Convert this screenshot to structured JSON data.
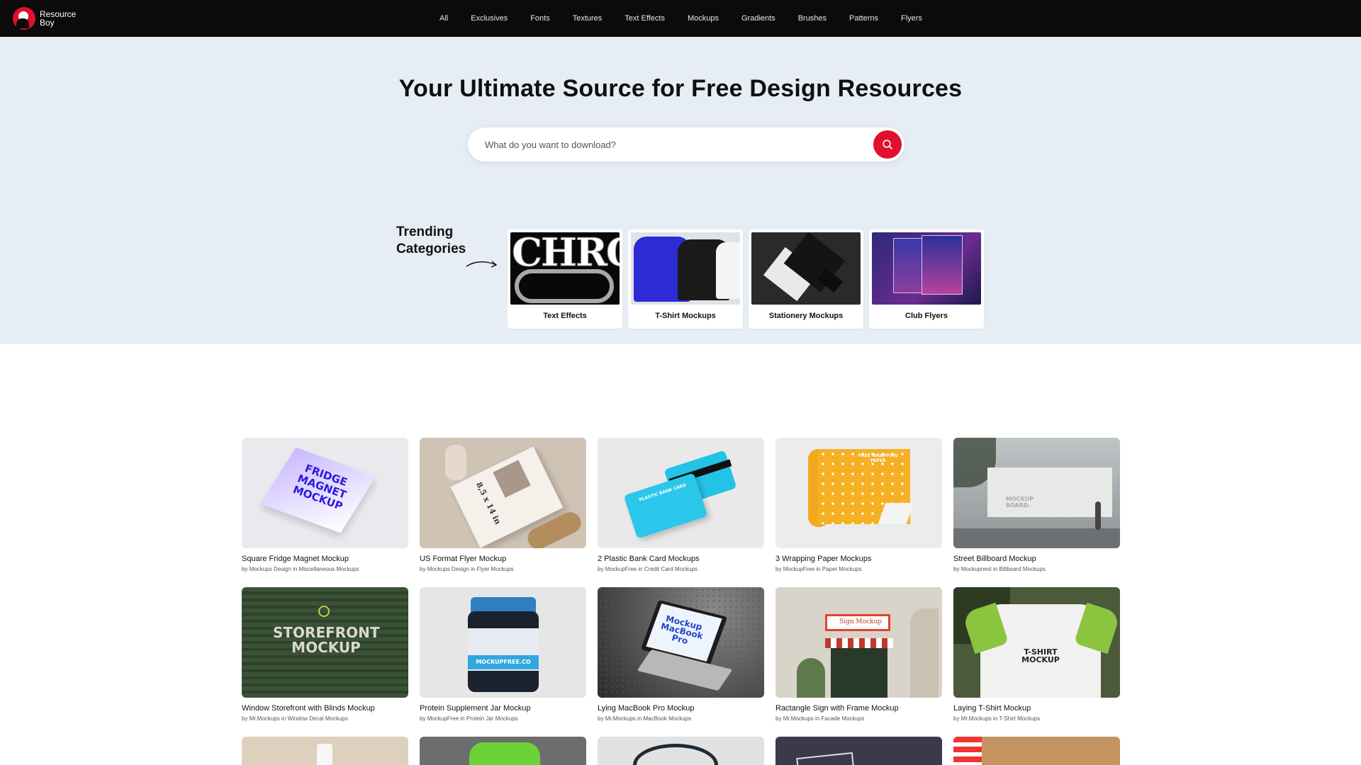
{
  "brand": {
    "name_line1": "Resource",
    "name_line2": "Boy",
    "accent": "#e0102f"
  },
  "nav": [
    "All",
    "Exclusives",
    "Fonts",
    "Textures",
    "Text Effects",
    "Mockups",
    "Gradients",
    "Brushes",
    "Patterns",
    "Flyers"
  ],
  "hero": {
    "title": "Your Ultimate Source for Free Design Resources",
    "search_placeholder": "What do you want to download?",
    "trending_line1": "Trending",
    "trending_line2": "Categories"
  },
  "categories": [
    {
      "label": "Text Effects",
      "art": "CHRO"
    },
    {
      "label": "T-Shirt Mockups"
    },
    {
      "label": "Stationery Mockups"
    },
    {
      "label": "Club Flyers"
    }
  ],
  "resources": [
    {
      "title": "Square Fridge Magnet Mockup",
      "by": "Mockups Design",
      "in": "Miscellaneous Mockups",
      "art": "FRIDGE MAGNET MOCKUP"
    },
    {
      "title": "US Format Flyer Mockup",
      "by": "Mockups Design",
      "in": "Flyer Mockups",
      "art": "8,5 x 14 in"
    },
    {
      "title": "2 Plastic Bank Card Mockups",
      "by": "MockupFree",
      "in": "Credit Card Mockups",
      "art": "PLASTIC BANK CARD"
    },
    {
      "title": "3 Wrapping Paper Mockups",
      "by": "MockupFree",
      "in": "Paper Mockups",
      "art": "FREE WRAPPING PAPER"
    },
    {
      "title": "Street Billboard Mockup",
      "by": "Mockupnest",
      "in": "Billboard Mockups",
      "art": "MOCKUP BOARD."
    },
    {
      "title": "Window Storefront with Blinds Mockup",
      "by": "Mr.Mockups",
      "in": "Window Decal Mockups",
      "art": "STOREFRONT MOCKUP"
    },
    {
      "title": "Protein Supplement Jar Mockup",
      "by": "MockupFree",
      "in": "Protein Jar Mockups",
      "art": "MOCKUPFREE.CO"
    },
    {
      "title": "Lying MacBook Pro Mockup",
      "by": "Mr.Mockups",
      "in": "MacBook Mockups",
      "art": "Mockup MacBook Pro"
    },
    {
      "title": "Ractangle Sign with Frame Mockup",
      "by": "Mr.Mockups",
      "in": "Facade Mockups",
      "art": "Sign Mockup"
    },
    {
      "title": "Laying T-Shirt Mockup",
      "by": "Mr.Mockups",
      "in": "T-Shirt Mockups",
      "art": "T-SHIRT MOCKUP"
    }
  ],
  "by_word": "by",
  "in_word": "in"
}
